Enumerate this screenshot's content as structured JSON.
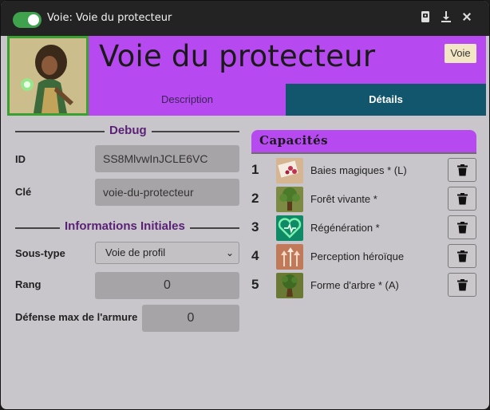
{
  "window": {
    "title": "Voie: Voie du protecteur"
  },
  "header": {
    "title": "Voie du protecteur",
    "type_badge": "Voie",
    "tabs": [
      {
        "label": "Description"
      },
      {
        "label": "Détails"
      }
    ]
  },
  "debug": {
    "heading": "Debug",
    "id_label": "ID",
    "id_value": "SS8MlvwInJCLE6VC",
    "key_label": "Clé",
    "key_value": "voie-du-protecteur"
  },
  "initial_info": {
    "heading": "Informations Initiales",
    "subtype_label": "Sous-type",
    "subtype_value": "Voie de profil",
    "rank_label": "Rang",
    "rank_value": "0",
    "armor_label": "Défense max de l'armure",
    "armor_value": "0"
  },
  "capacities": {
    "heading": "Capacités",
    "items": [
      {
        "num": "1",
        "name": "Baies magiques * (L)",
        "icon": "berries-icon",
        "color": "#c8a07a"
      },
      {
        "num": "2",
        "name": "Forêt vivante *",
        "icon": "living-tree-icon",
        "color": "#6e7a3a"
      },
      {
        "num": "3",
        "name": "Régénération *",
        "icon": "heart-heal-icon",
        "color": "#1aa06a"
      },
      {
        "num": "4",
        "name": "Perception héroïque",
        "icon": "arrows-up-icon",
        "color": "#c07a5a"
      },
      {
        "num": "5",
        "name": "Forme d'arbre * (A)",
        "icon": "tree-form-icon",
        "color": "#5a6a2a"
      }
    ]
  },
  "colors": {
    "accent": "#b64af0",
    "active_tab": "#12566e",
    "toggle": "#3fa34d"
  }
}
